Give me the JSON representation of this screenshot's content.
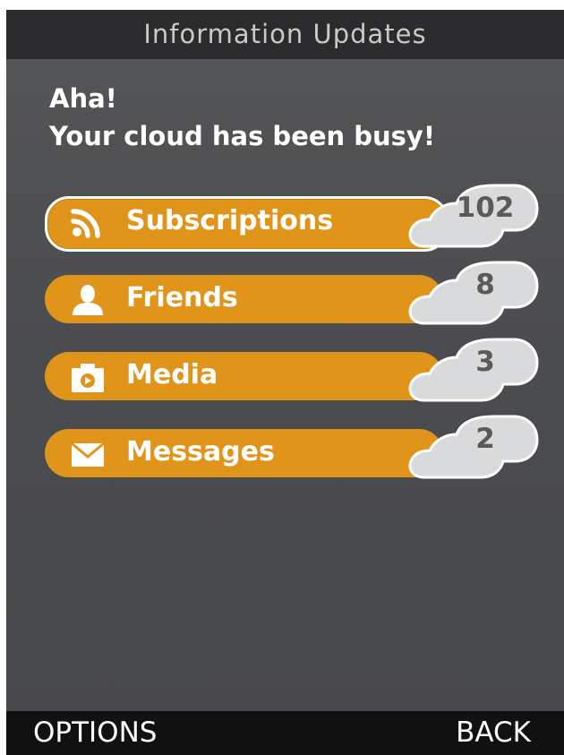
{
  "header": {
    "title": "Information Updates"
  },
  "headline": {
    "line1": "Aha!",
    "line2": "Your cloud has been busy!"
  },
  "items": [
    {
      "label": "Subscriptions",
      "count": "102",
      "icon": "rss-icon",
      "selected": true
    },
    {
      "label": "Friends",
      "count": "8",
      "icon": "person-icon",
      "selected": false
    },
    {
      "label": "Media",
      "count": "3",
      "icon": "camera-icon",
      "selected": false
    },
    {
      "label": "Messages",
      "count": "2",
      "icon": "envelope-icon",
      "selected": false
    }
  ],
  "softkeys": {
    "left": "OPTIONS",
    "right": "BACK"
  },
  "colors": {
    "accent": "#e0951a",
    "title_bar": "#2b2b2d",
    "background": "#4b4c4f",
    "cloud": "#d9dadb",
    "count_text": "#5a5a5a"
  }
}
